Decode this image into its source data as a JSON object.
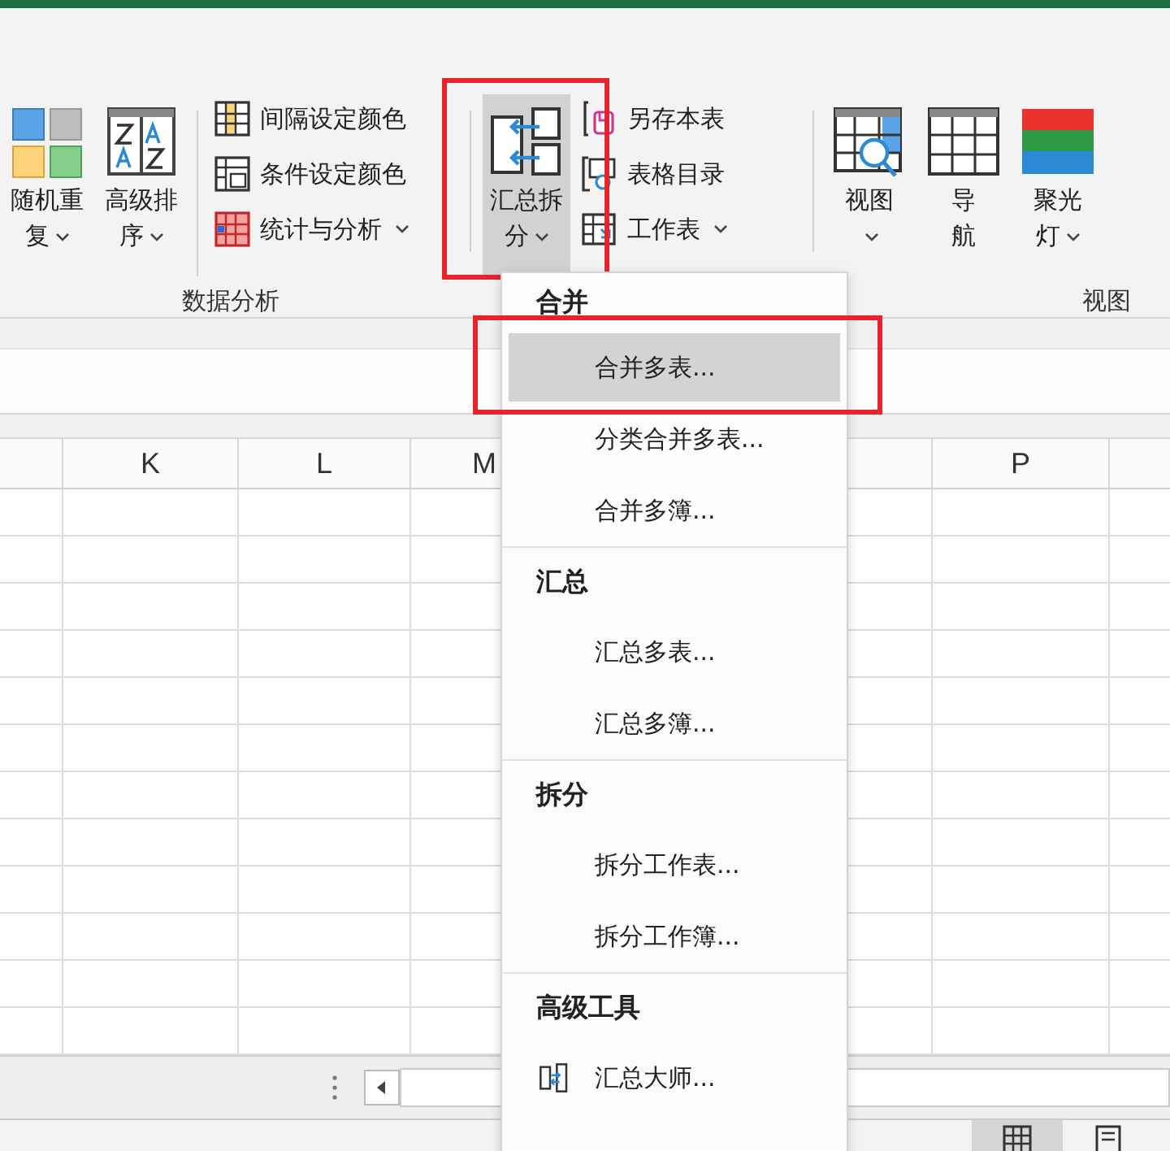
{
  "ribbon": {
    "groups": [
      {
        "label": "数据分析",
        "big_buttons": [
          {
            "lines": [
              "随机重",
              "复"
            ],
            "dropdown": true,
            "pressed": false,
            "highlighted": false
          },
          {
            "lines": [
              "高级排",
              "序"
            ],
            "dropdown": true,
            "pressed": false,
            "highlighted": false
          }
        ],
        "small_buttons": [
          {
            "label": "间隔设定颜色",
            "dropdown": false
          },
          {
            "label": "条件设定颜色",
            "dropdown": false
          },
          {
            "label": "统计与分析",
            "dropdown": true
          }
        ]
      },
      {
        "big_buttons": [
          {
            "lines": [
              "汇总拆",
              "分"
            ],
            "dropdown": true,
            "pressed": true,
            "highlighted": true
          }
        ],
        "small_buttons": [
          {
            "label": "另存本表",
            "dropdown": false
          },
          {
            "label": "表格目录",
            "dropdown": false
          },
          {
            "label": "工作表",
            "dropdown": true
          }
        ]
      },
      {
        "label": "视图",
        "big_buttons": [
          {
            "lines": [
              "视图"
            ],
            "dropdown": true,
            "pressed": false,
            "highlighted": false
          },
          {
            "lines": [
              "导",
              "航"
            ],
            "dropdown": false,
            "pressed": false,
            "highlighted": false
          },
          {
            "lines": [
              "聚光",
              "灯"
            ],
            "dropdown": true,
            "pressed": false,
            "highlighted": false
          }
        ]
      }
    ]
  },
  "sheet": {
    "columns": [
      "K",
      "L",
      "M",
      "P"
    ]
  },
  "menu": {
    "sections": [
      {
        "title": "合并",
        "items": [
          {
            "label": "合并多表...",
            "selected": true,
            "highlighted": true
          },
          {
            "label": "分类合并多表...",
            "selected": false,
            "highlighted": false
          },
          {
            "label": "合并多簿...",
            "selected": false,
            "highlighted": false
          }
        ]
      },
      {
        "title": "汇总",
        "items": [
          {
            "label": "汇总多表...",
            "selected": false,
            "highlighted": false
          },
          {
            "label": "汇总多簿...",
            "selected": false,
            "highlighted": false
          }
        ]
      },
      {
        "title": "拆分",
        "items": [
          {
            "label": "拆分工作表...",
            "selected": false,
            "highlighted": false
          },
          {
            "label": "拆分工作簿...",
            "selected": false,
            "highlighted": false
          }
        ]
      },
      {
        "title": "高级工具",
        "items": [
          {
            "label": "汇总大师...",
            "selected": false,
            "highlighted": false
          }
        ]
      }
    ]
  },
  "status_bar": {
    "views": [
      {
        "selected": true
      },
      {
        "selected": false
      }
    ]
  }
}
